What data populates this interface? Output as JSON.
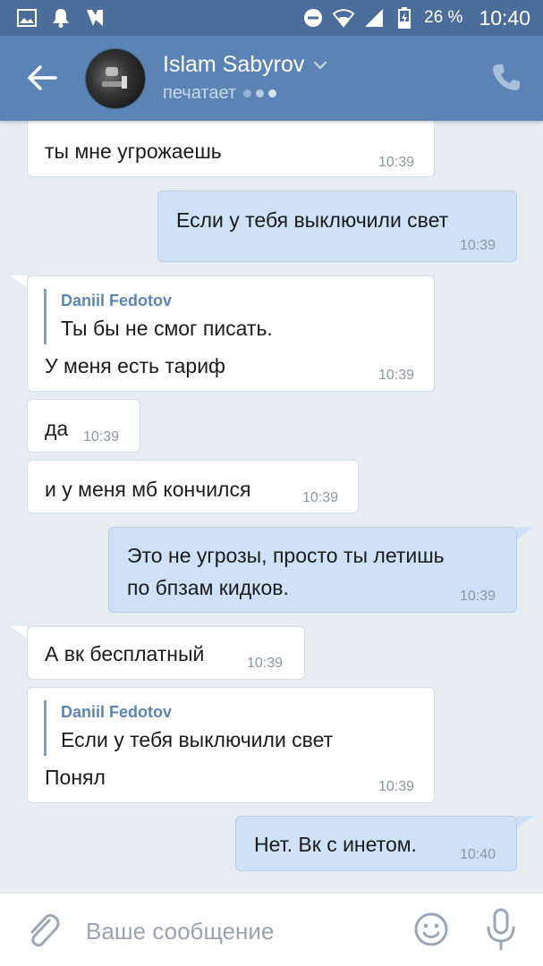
{
  "status_bar": {
    "battery_percent": "26 %",
    "time": "10:40",
    "icons": [
      "gallery-icon",
      "notification-bell-icon",
      "vk-icon",
      "do-not-disturb-icon",
      "wifi-icon",
      "signal-icon",
      "battery-charging-icon"
    ]
  },
  "header": {
    "contact_name": "Islam Sabyrov",
    "status": "печатает",
    "icons": [
      "back-arrow-icon",
      "chevron-down-icon",
      "phone-icon"
    ]
  },
  "messages": [
    {
      "direction": "in",
      "text": "ты мне угрожаешь",
      "time": "10:39"
    },
    {
      "direction": "out",
      "text": "Если у тебя выключили свет",
      "time": "10:39"
    },
    {
      "direction": "in",
      "quote_author": "Daniil Fedotov",
      "quote_text": "Ты бы не смог писать.",
      "text": "У меня есть тариф",
      "time": "10:39"
    },
    {
      "direction": "in",
      "text": "да",
      "time": "10:39"
    },
    {
      "direction": "in",
      "text": "и у меня мб кончился",
      "time": "10:39"
    },
    {
      "direction": "out",
      "lines": [
        "Это не угрозы, просто ты летишь",
        "по бпзам кидков."
      ],
      "time": "10:39"
    },
    {
      "direction": "in",
      "text": "А вк бесплатный",
      "time": "10:39"
    },
    {
      "direction": "in",
      "quote_author": "Daniil Fedotov",
      "quote_text": "Если у тебя выключили свет",
      "text": "Понял",
      "time": "10:39"
    },
    {
      "direction": "out",
      "text": "Нет. Вк с инетом.",
      "time": "10:40"
    }
  ],
  "input_bar": {
    "placeholder": "Ваше сообщение",
    "icons": [
      "paperclip-icon",
      "emoji-icon",
      "microphone-icon"
    ]
  },
  "colors": {
    "status_bar_bg": "#4a6e99",
    "header_bg": "#5b84b4",
    "chat_bg": "#e7ecf1",
    "incoming_bubble": "#ffffff",
    "outgoing_bubble": "#cfe1f6",
    "quote_author": "#5b84b4"
  }
}
